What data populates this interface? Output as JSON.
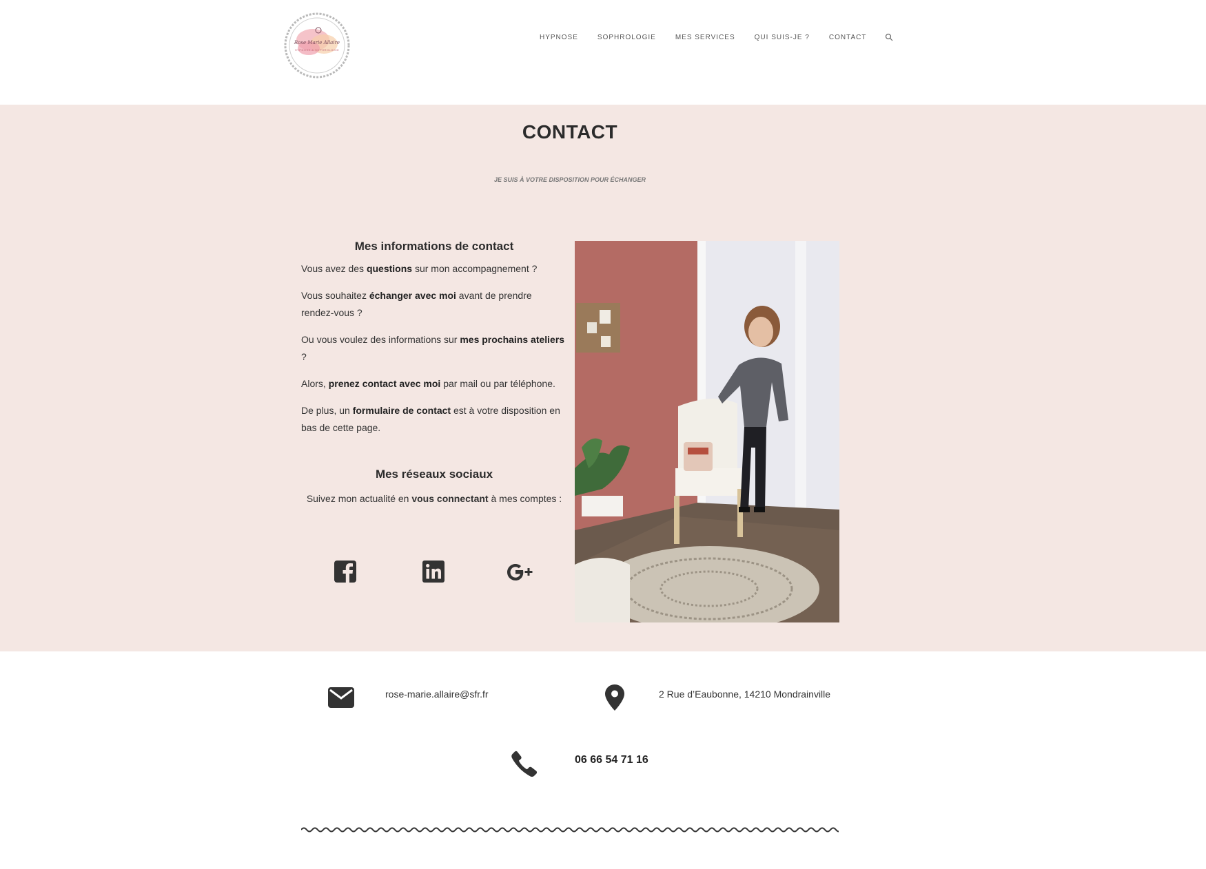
{
  "logo": {
    "name_text": "Rose Marie Allaire",
    "tagline_text": "HYPNOSE & SOPHROLOGIE"
  },
  "nav": {
    "items": [
      {
        "label": "HYPNOSE"
      },
      {
        "label": "SOPHROLOGIE"
      },
      {
        "label": "MES SERVICES"
      },
      {
        "label": "QUI SUIS-JE ?"
      },
      {
        "label": "CONTACT"
      }
    ],
    "search_icon": "search-icon"
  },
  "page": {
    "title": "CONTACT",
    "subtitle": "JE SUIS À VOTRE DISPOSITION POUR ÉCHANGER"
  },
  "contact_info": {
    "heading": "Mes informations de contact",
    "p1_a": "Vous avez des ",
    "p1_b": "questions",
    "p1_c": " sur mon accompagnement ?",
    "p2_a": "Vous souhaitez ",
    "p2_b": "échanger avec moi",
    "p2_c": " avant de prendre rendez-vous ?",
    "p3_a": "Ou vous voulez des informations sur ",
    "p3_b": "mes prochains ateliers",
    "p3_c": " ?",
    "p4_a": "Alors, ",
    "p4_b": "prenez contact avec moi",
    "p4_c": " par mail ou par téléphone.",
    "p5_a": "De plus, un ",
    "p5_b": "formulaire de contact",
    "p5_c": " est à votre disposition en bas de cette page."
  },
  "social": {
    "heading": "Mes réseaux sociaux",
    "text_a": "Suivez mon actualité en ",
    "text_b": "vous connectant",
    "text_c": " à mes comptes :",
    "icons": [
      "facebook-icon",
      "linkedin-icon",
      "google-plus-icon"
    ]
  },
  "details": {
    "email": "rose-marie.allaire@sfr.fr",
    "address": "2 Rue d’Eaubonne, 14210 Mondrainville",
    "phone": "06 66 54 71 16"
  },
  "colors": {
    "band_background": "#f4e7e3",
    "icon_color": "#333333",
    "wall_accent": "#b46b64"
  }
}
